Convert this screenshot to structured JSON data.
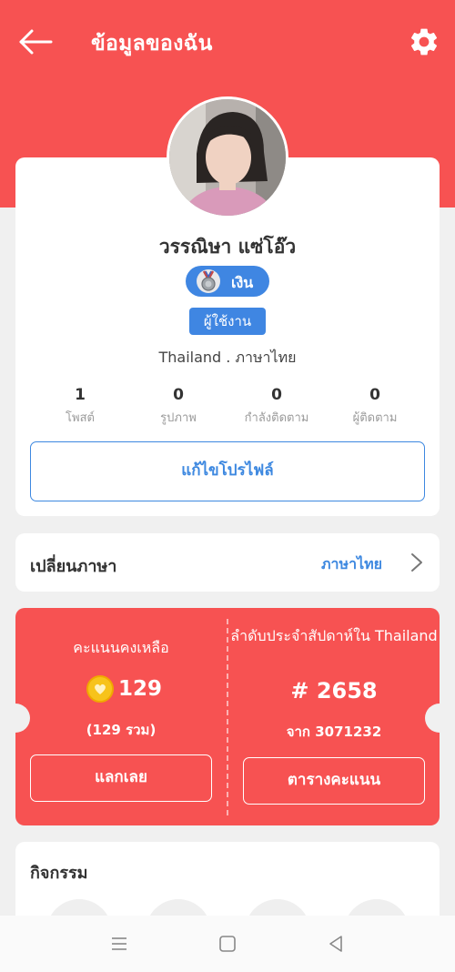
{
  "header": {
    "title": "ข้อมูลของฉัน"
  },
  "profile": {
    "name": "วรรณิษา แซ่โอ๊ว",
    "tier": "เงิน",
    "role": "ผู้ใช้งาน",
    "location": "Thailand . ภาษาไทย",
    "stats": [
      {
        "value": "1",
        "label": "โพสต์"
      },
      {
        "value": "0",
        "label": "รูปภาพ"
      },
      {
        "value": "0",
        "label": "กำลังติดตาม"
      },
      {
        "value": "0",
        "label": "ผู้ติดตาม"
      }
    ],
    "edit_label": "แก้ไขโปรไฟล์"
  },
  "language": {
    "title": "เปลี่ยนภาษา",
    "value": "ภาษาไทย"
  },
  "points": {
    "balance_label": "คะแนนคงเหลือ",
    "balance_value": "129",
    "balance_total": "(129 รวม)",
    "redeem_label": "แลกเลย",
    "rank_title": "ลำดับประจำสัปดาห์ใน Thailand",
    "rank_value": "# 2658",
    "rank_from": "จาก 3071232",
    "leaderboard_label": "ตารางคะแนน"
  },
  "activity": {
    "title": "กิจกรรม"
  },
  "colors": {
    "brand_red": "#f75252",
    "accent_blue": "#3d88e0",
    "coin_gold": "#f7c31b"
  },
  "icons": [
    "back-arrow-icon",
    "gear-icon",
    "medal-icon",
    "chevron-right-icon",
    "coin-icon",
    "menu-icon",
    "home-square-icon",
    "back-triangle-icon"
  ]
}
